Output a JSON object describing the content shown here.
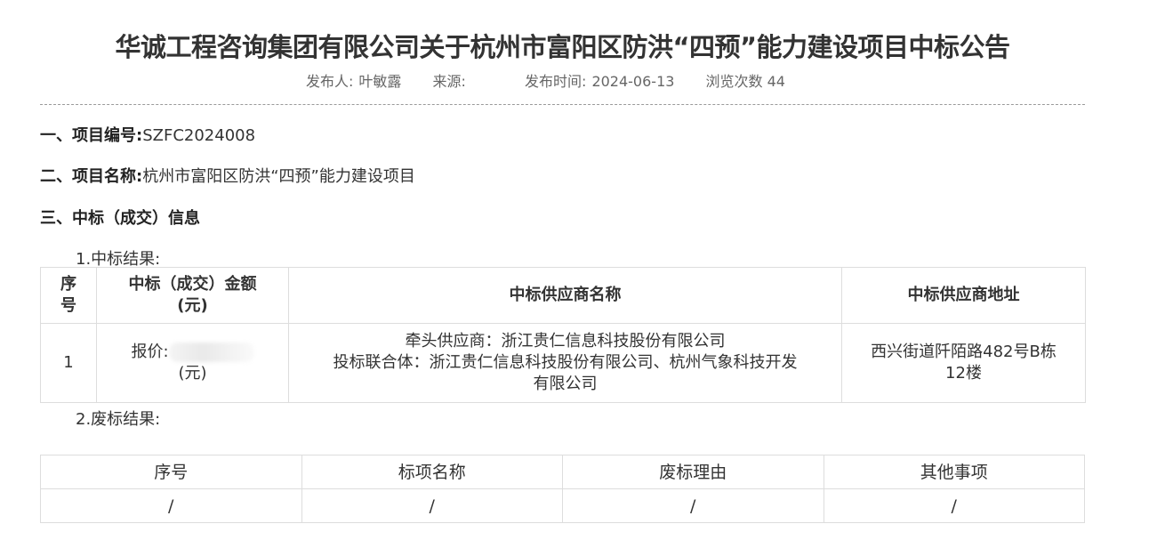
{
  "title": "华诚工程咨询集团有限公司关于杭州市富阳区防洪“四预”能力建设项目中标公告",
  "meta": {
    "publisher_label": "发布人:",
    "publisher": "叶敏露",
    "source_label": "来源:",
    "source": "",
    "time_label": "发布时间:",
    "time": "2024-06-13",
    "views_label": "浏览次数",
    "views": "44"
  },
  "sections": {
    "s1_heading": "一、项目编号:",
    "s1_value": "SZFC2024008",
    "s2_heading": "二、项目名称:",
    "s2_value": "杭州市富阳区防洪“四预”能力建设项目",
    "s3_heading": "三、中标（成交）信息",
    "s3_sub1": "1.中标结果:",
    "s3_sub2": "2.废标结果:"
  },
  "result_table": {
    "headers": [
      "序号",
      "中标（成交）金额（元）",
      "中标供应商名称",
      "中标供应商地址"
    ],
    "header_lines": {
      "seq": [
        "序",
        "号"
      ],
      "amount": [
        "中标（成交）金额",
        "(元)"
      ]
    },
    "row": {
      "seq": "1",
      "price_label": "报价:",
      "price_unit": "(元)",
      "lead_supplier": "牵头供应商：浙江贵仁信息科技股份有限公司",
      "consortium_line1": "投标联合体：浙江贵仁信息科技股份有限公司、杭州气象科技开发",
      "consortium_line2": "有限公司",
      "address_line1": "西兴街道阡陌路482号B栋",
      "address_line2": "12楼"
    }
  },
  "invalid_table": {
    "headers": [
      "序号",
      "标项名称",
      "废标理由",
      "其他事项"
    ],
    "row": [
      "/",
      "/",
      "/",
      "/"
    ]
  }
}
